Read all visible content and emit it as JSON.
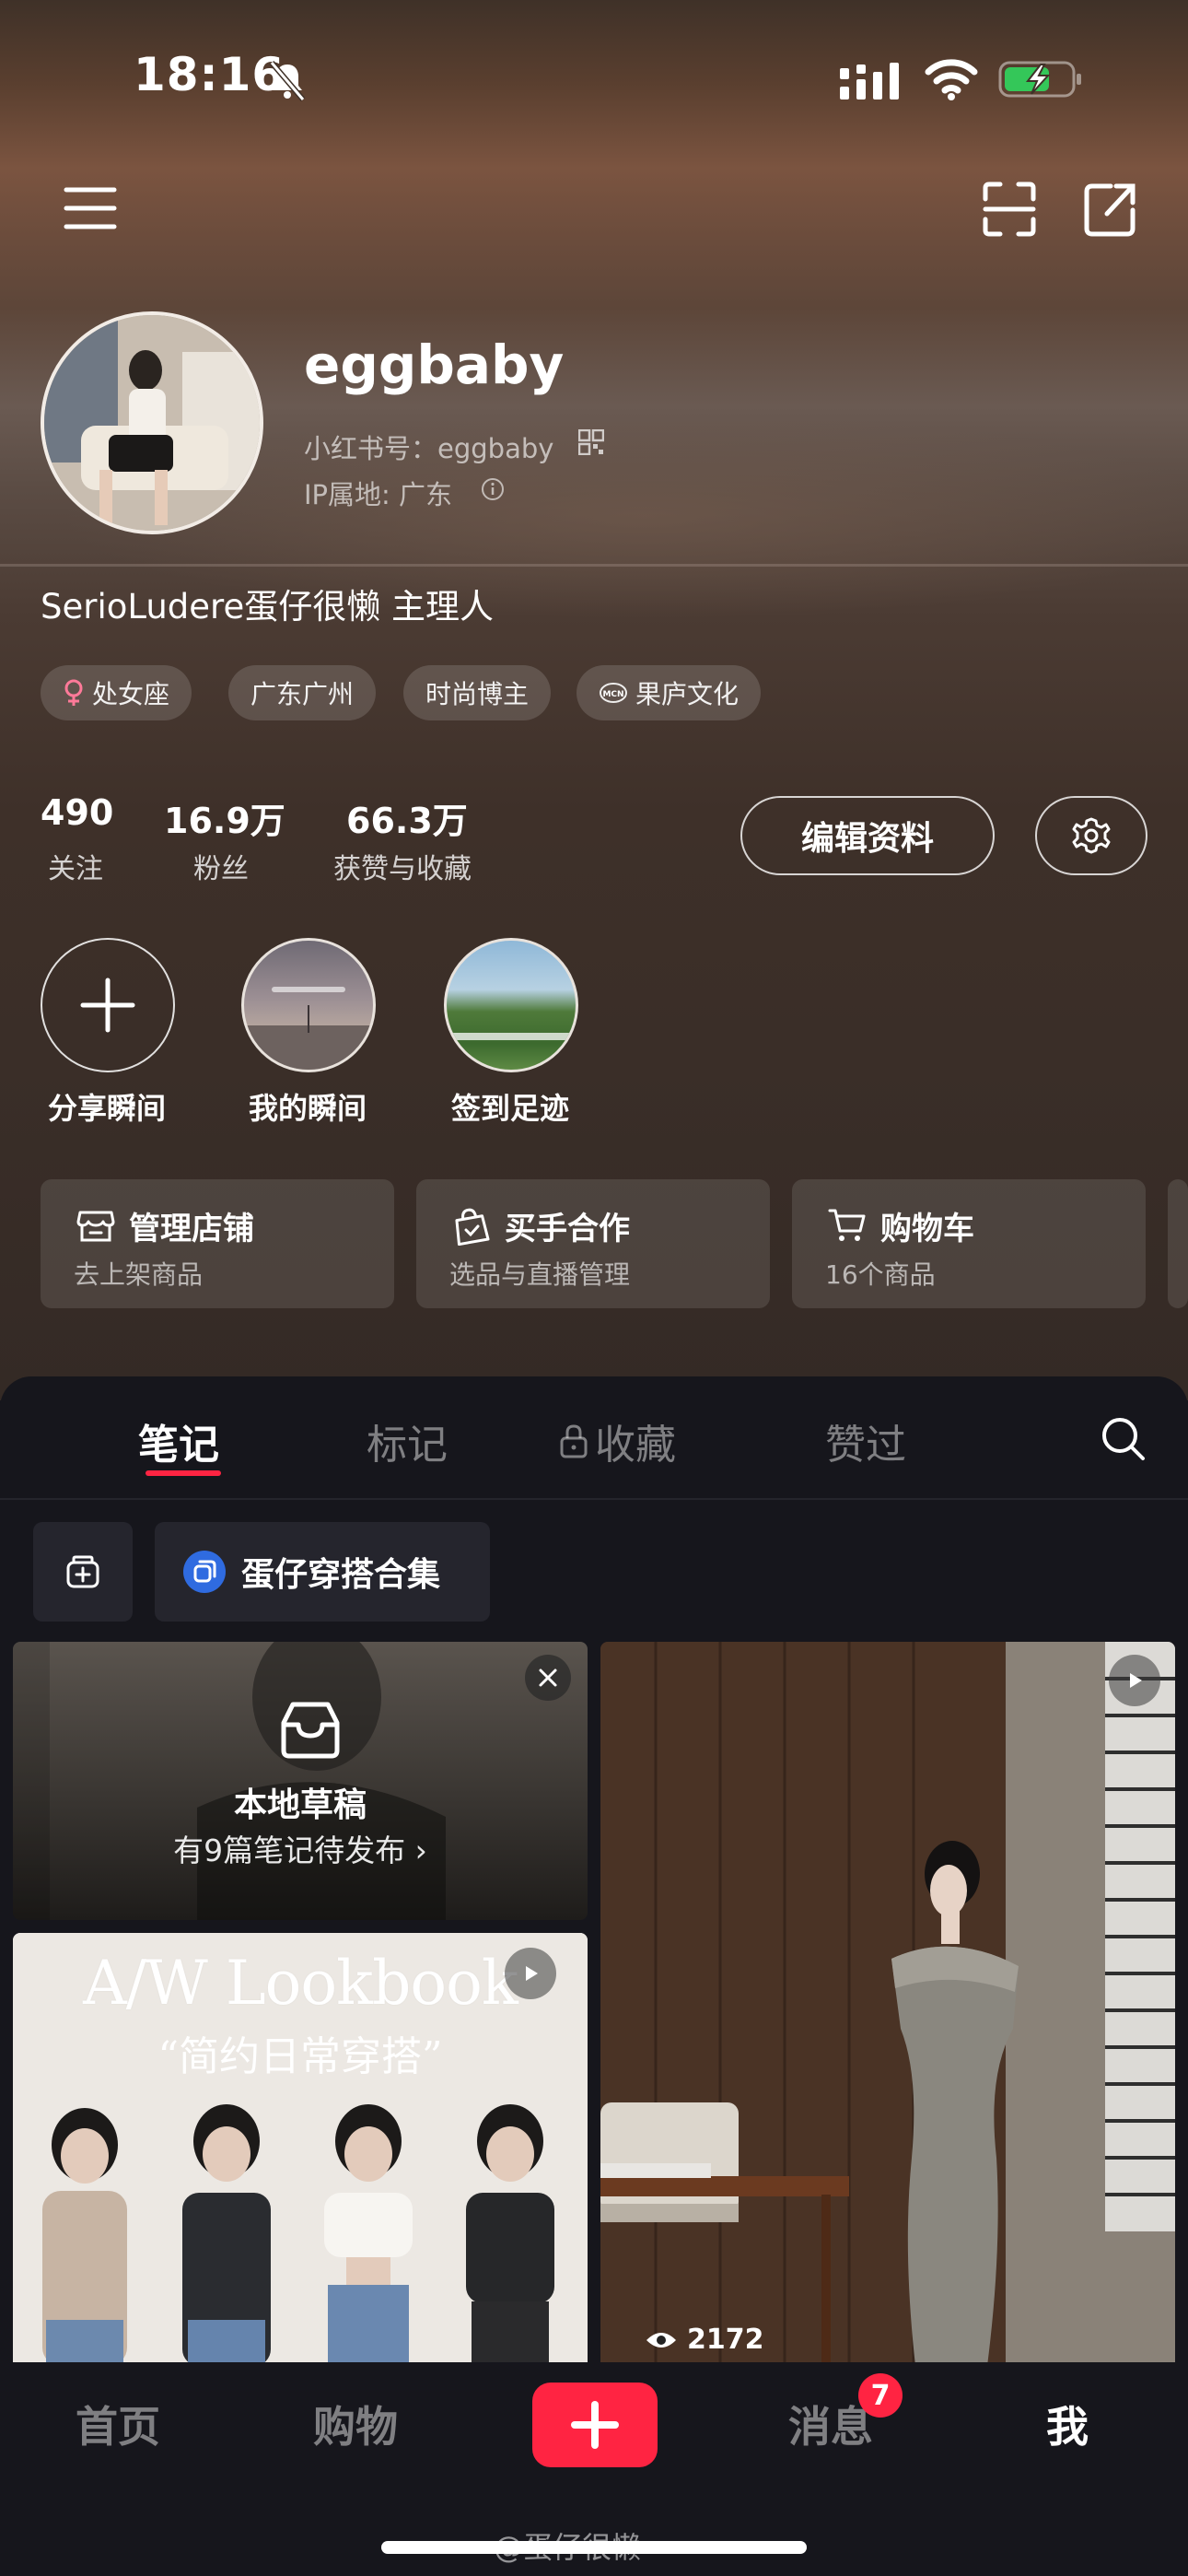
{
  "status_bar": {
    "time": "18:16"
  },
  "profile": {
    "username": "eggbaby",
    "rednote_id": "小红书号：eggbaby",
    "ip_location": "IP属地: 广东",
    "bio": "SerioLudere蛋仔很懒 主理人",
    "tags": [
      "处女座",
      "广东广州",
      "时尚博主",
      "果庐文化"
    ]
  },
  "stats": [
    {
      "value": "490",
      "label": "关注"
    },
    {
      "value": "16.9万",
      "label": "粉丝"
    },
    {
      "value": "66.3万",
      "label": "获赞与收藏"
    }
  ],
  "buttons": {
    "edit_profile": "编辑资料"
  },
  "moments": [
    "分享瞬间",
    "我的瞬间",
    "签到足迹"
  ],
  "cards": [
    {
      "title": "管理店铺",
      "subtitle": "去上架商品"
    },
    {
      "title": "买手合作",
      "subtitle": "选品与直播管理"
    },
    {
      "title": "购物车",
      "subtitle": "16个商品"
    }
  ],
  "tabs": [
    "笔记",
    "标记",
    "收藏",
    "赞过"
  ],
  "album": {
    "name": "蛋仔穿搭合集"
  },
  "feed": {
    "draft_title": "本地草稿",
    "draft_sub": "有9篇笔记待发布",
    "lookbook_title": "A/W Lookbook",
    "lookbook_sub": "“简约日常穿搭”",
    "views": "2172"
  },
  "bottom_nav": {
    "home": "首页",
    "shop": "购物",
    "messages": "消息",
    "me": "我",
    "badge": "7"
  },
  "watermark": "@蛋仔很懒",
  "colors": {
    "accent": "#ff2442",
    "panel_bg": "#16161c"
  }
}
